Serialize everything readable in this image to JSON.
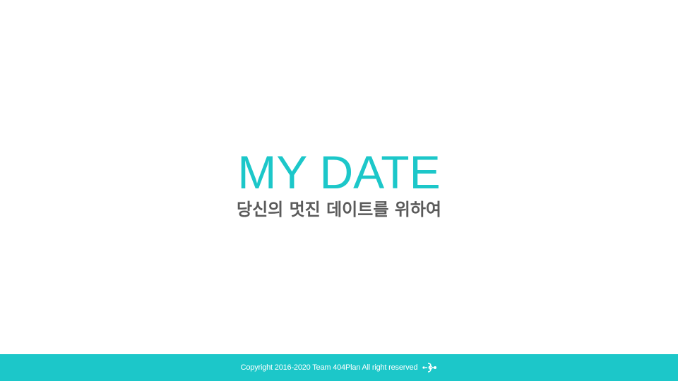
{
  "slide": {
    "title": "MY DATE",
    "subtitle": "당신의 멋진 데이트를 위하여"
  },
  "footer": {
    "copyright": "Copyright 2016-2020 Team 404Plan All right reserved",
    "logo_icon": "team-logo-icon"
  },
  "colors": {
    "accent": "#1cc7c9",
    "subtitle": "#5a5a5a",
    "background": "#ffffff"
  }
}
